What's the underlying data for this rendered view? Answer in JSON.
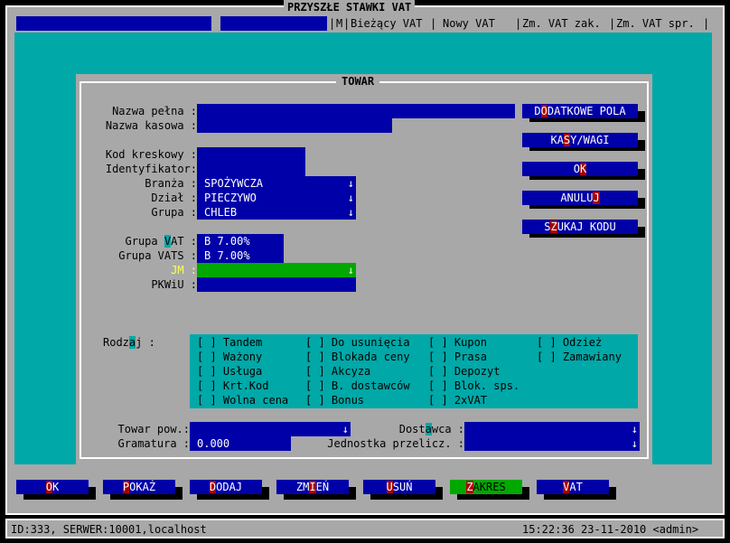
{
  "window": {
    "title": "PRZYSZŁE STAWKI VAT"
  },
  "tabs": [
    {
      "label": "M"
    },
    {
      "label": "Bieżący VAT"
    },
    {
      "label": "Nowy VAT"
    },
    {
      "label": "Zm. VAT zak."
    },
    {
      "label": "Zm. VAT spr."
    }
  ],
  "dialog": {
    "title": "TOWAR"
  },
  "form": {
    "nazwa_pelna": {
      "label": "Nazwa pełna :",
      "value": ""
    },
    "nazwa_kasowa": {
      "label": "Nazwa kasowa :",
      "value": ""
    },
    "kod_kreskowy": {
      "label": "Kod kreskowy :",
      "value": ""
    },
    "identyfikator": {
      "label": "Identyfikator:",
      "value": ""
    },
    "branza": {
      "label": "Branża :",
      "value": "SPOŻYWCZA"
    },
    "dzial": {
      "label": "Dział :",
      "value": "PIECZYWO"
    },
    "grupa": {
      "label": "Grupa :",
      "value": "CHLEB"
    },
    "grupa_vat": {
      "label_pre": "Grupa ",
      "label_hk": "V",
      "label_post": "AT :",
      "value": "B 7.00%"
    },
    "grupa_vats": {
      "label": "Grupa VATS :",
      "value": "B 7.00%"
    },
    "jm": {
      "label": "JM :",
      "value": ""
    },
    "pkwiu": {
      "label": "PKWiU :",
      "value": ""
    },
    "rodzaj": {
      "label_pre": "Rodz",
      "label_hk": "a",
      "label_post": "j :"
    },
    "towar_pow": {
      "label": "Towar pow.:",
      "value": ""
    },
    "gramatura": {
      "label": "Gramatura :",
      "value": "0.000"
    },
    "dostawca": {
      "label_pre": "Dost",
      "label_hk": "a",
      "label_post": "wca :",
      "value": ""
    },
    "jednostka_przelicz": {
      "label": "Jednostka przelicz. :",
      "value": ""
    }
  },
  "arrow_glyph": "↓",
  "side_buttons": [
    {
      "pre": "D",
      "hk": "O",
      "post": "DATKOWE POLA"
    },
    {
      "pre": "KA",
      "hk": "S",
      "post": "Y/WAGI"
    },
    {
      "pre": "O",
      "hk": "K",
      "post": ""
    },
    {
      "pre": "ANULU",
      "hk": "J",
      "post": ""
    },
    {
      "pre": "S",
      "hk": "Z",
      "post": "UKAJ KODU"
    }
  ],
  "checkbox_columns": [
    [
      "[ ] Tandem",
      "[ ] Ważony",
      "[ ] Usługa",
      "[ ] Krt.Kod",
      "[ ] Wolna cena"
    ],
    [
      "[ ] Do usunięcia",
      "[ ] Blokada ceny",
      "[ ] Akcyza",
      "[ ] B. dostawców",
      "[ ] Bonus"
    ],
    [
      "[ ] Kupon",
      "[ ] Prasa",
      "[ ] Depozyt",
      "[ ] Blok. sps.",
      "[ ] 2xVAT"
    ],
    [
      "[ ] Odzież",
      "[ ] Zamawiany"
    ]
  ],
  "bottom_buttons": [
    {
      "pre": "",
      "hk": "O",
      "post": "K",
      "active": false
    },
    {
      "pre": "",
      "hk": "P",
      "post": "OKAŻ",
      "active": false
    },
    {
      "pre": "",
      "hk": "D",
      "post": "ODAJ",
      "active": false
    },
    {
      "pre": "ZM",
      "hk": "I",
      "post": "EŃ",
      "active": false
    },
    {
      "pre": "",
      "hk": "U",
      "post": "SUŃ",
      "active": false
    },
    {
      "pre": "",
      "hk": "Z",
      "post": "AKRES",
      "active": true
    },
    {
      "pre": "",
      "hk": "V",
      "post": "AT",
      "active": false
    }
  ],
  "status": {
    "left": "ID:333, SERWER:10001,localhost",
    "right": "15:22:36 23-11-2010 <admin>"
  },
  "colors": {
    "blue": "#0000a8",
    "teal": "#00a8a8",
    "gray": "#a8a8a8",
    "green": "#00a800",
    "red": "#a80000",
    "yellow": "#ffff55"
  }
}
